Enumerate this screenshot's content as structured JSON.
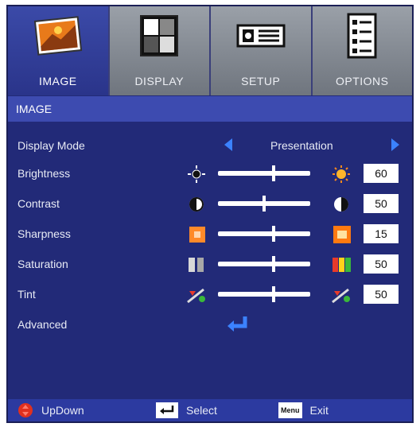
{
  "tabs": [
    {
      "label": "IMAGE",
      "icon": "image-icon",
      "active": true
    },
    {
      "label": "DISPLAY",
      "icon": "display-icon",
      "active": false
    },
    {
      "label": "SETUP",
      "icon": "setup-icon",
      "active": false
    },
    {
      "label": "OPTIONS",
      "icon": "options-icon",
      "active": false
    }
  ],
  "section_title": "IMAGE",
  "display_mode": {
    "label": "Display Mode",
    "value": "Presentation"
  },
  "sliders": [
    {
      "label": "Brightness",
      "value": "60",
      "level": 0.6,
      "left_icon": "sun-small-icon",
      "right_icon": "sun-large-icon"
    },
    {
      "label": "Contrast",
      "value": "50",
      "level": 0.5,
      "left_icon": "contrast-dark-icon",
      "right_icon": "contrast-light-icon"
    },
    {
      "label": "Sharpness",
      "value": "15",
      "level": 0.6,
      "left_icon": "sharpness-low-icon",
      "right_icon": "sharpness-high-icon"
    },
    {
      "label": "Saturation",
      "value": "50",
      "level": 0.6,
      "left_icon": "saturation-gray-icon",
      "right_icon": "saturation-color-icon"
    },
    {
      "label": "Tint",
      "value": "50",
      "level": 0.6,
      "left_icon": "tint-red-icon",
      "right_icon": "tint-green-icon"
    }
  ],
  "advanced": {
    "label": "Advanced",
    "icon": "enter-icon"
  },
  "footer": {
    "updown": "UpDown",
    "select": "Select",
    "menu_key": "Menu",
    "exit": "Exit"
  },
  "colors": {
    "panel": "#222a78",
    "accent": "#3b82ff",
    "header": "#3d4bb0"
  }
}
